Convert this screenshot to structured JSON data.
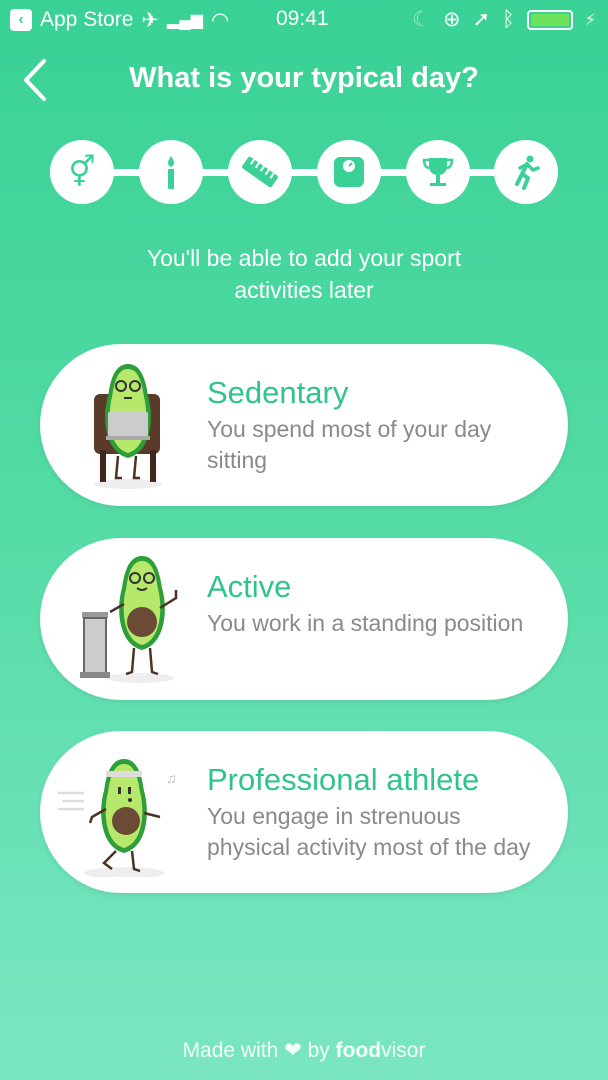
{
  "status_bar": {
    "back_app": "App Store",
    "time": "09:41",
    "icons": [
      "airplane-icon",
      "signal-icon",
      "wifi-icon",
      "moon-icon",
      "rotation-lock-icon",
      "location-icon",
      "bluetooth-icon",
      "battery-icon",
      "charging-icon"
    ]
  },
  "nav": {
    "back_icon": "chevron-left-icon",
    "title": "What is your typical day?"
  },
  "steps": [
    {
      "name": "gender",
      "icon": "gender-icon",
      "glyph": "⚥"
    },
    {
      "name": "age",
      "icon": "candle-icon",
      "glyph": "🕯"
    },
    {
      "name": "height",
      "icon": "ruler-icon",
      "glyph": "📏"
    },
    {
      "name": "weight",
      "icon": "scale-icon",
      "glyph": "⚖"
    },
    {
      "name": "goal",
      "icon": "trophy-icon",
      "glyph": "🏆"
    },
    {
      "name": "activity",
      "icon": "running-icon",
      "glyph": "🏃"
    }
  ],
  "subtitle": "You'll be able to add your sport activities later",
  "options": [
    {
      "title": "Sedentary",
      "description": "You spend most of your day sitting",
      "illustration": "avocado-sitting-laptop"
    },
    {
      "title": "Active",
      "description": "You work in a standing position",
      "illustration": "avocado-standing-podium"
    },
    {
      "title": "Professional athlete",
      "description": "You engage in strenuous physical activity most of the day",
      "illustration": "avocado-running"
    }
  ],
  "footer": {
    "made_with": "Made with",
    "by": "by",
    "brand_bold": "food",
    "brand_light": "visor",
    "heart_icon": "heart-icon"
  },
  "colors": {
    "accent": "#39d195",
    "title_green": "#2fc48c",
    "desc_gray": "#8a8a8a"
  }
}
